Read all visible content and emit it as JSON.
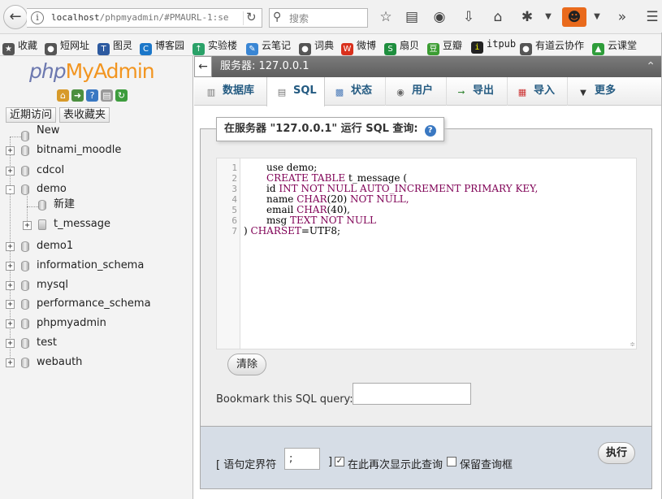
{
  "browser": {
    "url_host": "localhost",
    "url_path": "/phpmyadmin/#PMAURL-1:se",
    "search_placeholder": "搜索"
  },
  "bookmarks": [
    {
      "label": "收藏",
      "color": "#555"
    },
    {
      "label": "短网址",
      "color": "#555"
    },
    {
      "label": "图灵",
      "color": "#2d5aa0"
    },
    {
      "label": "博客园",
      "color": "#1b77c9"
    },
    {
      "label": "实验楼",
      "color": "#2aa168"
    },
    {
      "label": "云笔记",
      "color": "#3a86d4"
    },
    {
      "label": "词典",
      "color": "#555"
    },
    {
      "label": "微博",
      "color": "#d9301c"
    },
    {
      "label": "扇贝",
      "color": "#1e8e3e"
    },
    {
      "label": "豆瓣",
      "color": "#3b9c32"
    },
    {
      "label": "itpub",
      "color": "#222"
    },
    {
      "label": "有道云协作",
      "color": "#555"
    },
    {
      "label": "云课堂",
      "color": "#2e9d3a"
    }
  ],
  "nav": {
    "logo_php": "php",
    "logo_my": "My",
    "logo_admin": "Admin",
    "recent_btn": "近期访问",
    "favorites_btn": "表收藏夹",
    "tree": {
      "new_label": "New",
      "dbs": [
        "bitnami_moodle",
        "cdcol",
        "demo",
        "demo1",
        "information_schema",
        "mysql",
        "performance_schema",
        "phpmyadmin",
        "test",
        "webauth"
      ],
      "demo_new": "新建",
      "demo_table": "t_message"
    }
  },
  "server_bar": {
    "title": "服务器: 127.0.0.1"
  },
  "tabs": [
    {
      "label": "数据库"
    },
    {
      "label": "SQL"
    },
    {
      "label": "状态"
    },
    {
      "label": "用户"
    },
    {
      "label": "导出"
    },
    {
      "label": "导入"
    },
    {
      "label": "更多"
    }
  ],
  "sql_panel": {
    "legend": "在服务器 \"127.0.0.1\" 运行 SQL 查询:",
    "clear_btn": "清除",
    "bookmark_label": "Bookmark this SQL query:",
    "line_numbers": [
      "1",
      "2",
      "3",
      "4",
      "5",
      "6",
      "7"
    ],
    "code_lines": {
      "l1_a": "use demo;",
      "l2_a": "CREATE",
      "l2_b": "TABLE",
      "l2_c": "t_message (",
      "l3_a": "id",
      "l3_b": "INT",
      "l3_c": "NOT",
      "l3_d": "NULL",
      "l3_e": "AUTO_INCREMENT",
      "l3_f": "PRIMARY",
      "l3_g": "KEY,",
      "l4_a": "name",
      "l4_b": "CHAR",
      "l4_c": "(20)",
      "l4_d": "NOT",
      "l4_e": "NULL,",
      "l5_a": "email",
      "l5_b": "CHAR",
      "l5_c": "(40),",
      "l6_a": "msg",
      "l6_b": "TEXT",
      "l6_c": "NOT",
      "l6_d": "NULL",
      "l7_a": ")",
      "l7_b": "CHARSET",
      "l7_c": "=UTF8;"
    }
  },
  "footer": {
    "delimiter_label": "[ 语句定界符",
    "delimiter_value": ";",
    "close_bracket": "]",
    "show_again_label": "在此再次显示此查询",
    "keep_box_label": "保留查询框",
    "show_again_checked": true,
    "keep_box_checked": false,
    "go_btn": "执行"
  }
}
